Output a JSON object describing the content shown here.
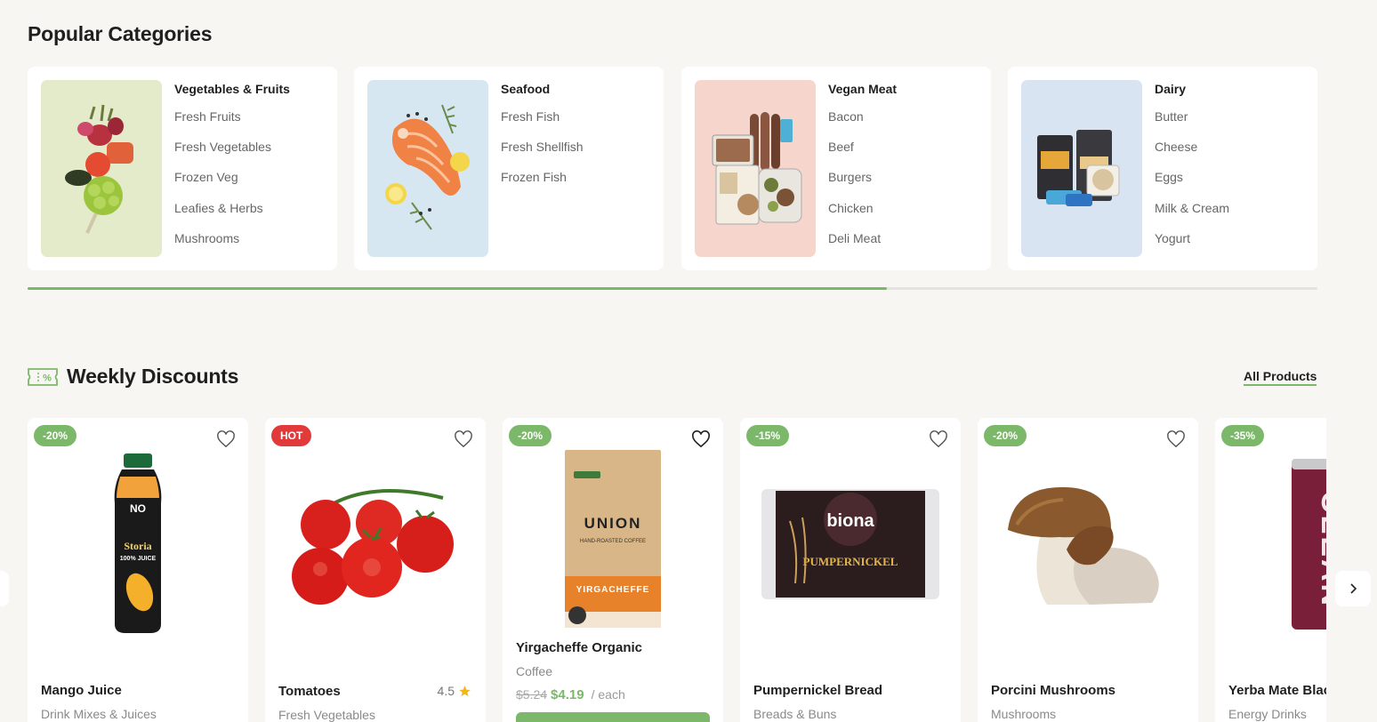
{
  "categories_section": {
    "title": "Popular Categories",
    "cards": [
      {
        "name": "Vegetables & Fruits",
        "items": [
          "Fresh Fruits",
          "Fresh Vegetables",
          "Frozen Veg",
          "Leafies & Herbs",
          "Mushrooms"
        ],
        "bg": "#e3ebcb"
      },
      {
        "name": "Seafood",
        "items": [
          "Fresh Fish",
          "Fresh Shellfish",
          "Frozen Fish"
        ],
        "bg": "#d7e7f1"
      },
      {
        "name": "Vegan Meat",
        "items": [
          "Bacon",
          "Beef",
          "Burgers",
          "Chicken",
          "Deli Meat"
        ],
        "bg": "#f6d5cd"
      },
      {
        "name": "Dairy",
        "items": [
          "Butter",
          "Cheese",
          "Eggs",
          "Milk & Cream",
          "Yogurt"
        ],
        "bg": "#d9e4f2"
      }
    ],
    "scroll_progress": 0.666
  },
  "discounts_section": {
    "title": "Weekly Discounts",
    "all_products_label": "All Products",
    "products": [
      {
        "badge": "-20%",
        "name": "Mango Juice",
        "category": "Drink Mixes & Juices"
      },
      {
        "badge": "HOT",
        "name": "Tomatoes",
        "category": "Fresh Vegetables",
        "rating": "4.5"
      },
      {
        "badge": "-20%",
        "name": "Yirgacheffe Organic",
        "category": "Coffee",
        "old_price": "$5.24",
        "new_price": "$4.19",
        "unit": "/ each"
      },
      {
        "badge": "-15%",
        "name": "Pumpernickel Bread",
        "category": "Breads & Buns"
      },
      {
        "badge": "-20%",
        "name": "Porcini Mushrooms",
        "category": "Mushrooms"
      },
      {
        "badge": "-35%",
        "name": "Yerba Mate Black",
        "category": "Energy Drinks"
      }
    ]
  },
  "product_art": {
    "juice_brand": "Storia",
    "juice_tag": "100% JUICE",
    "coffee_brand": "UNION",
    "coffee_sub": "HAND-ROASTED COFFEE",
    "coffee_origin": "YIRGACHEFFE",
    "bread_brand": "biona",
    "bread_name": "PUMPERNICKEL",
    "can_text": "CLEAN"
  },
  "colors": {
    "accent": "#7cb86a",
    "hot": "#e03a3a",
    "background": "#f7f6f2"
  }
}
